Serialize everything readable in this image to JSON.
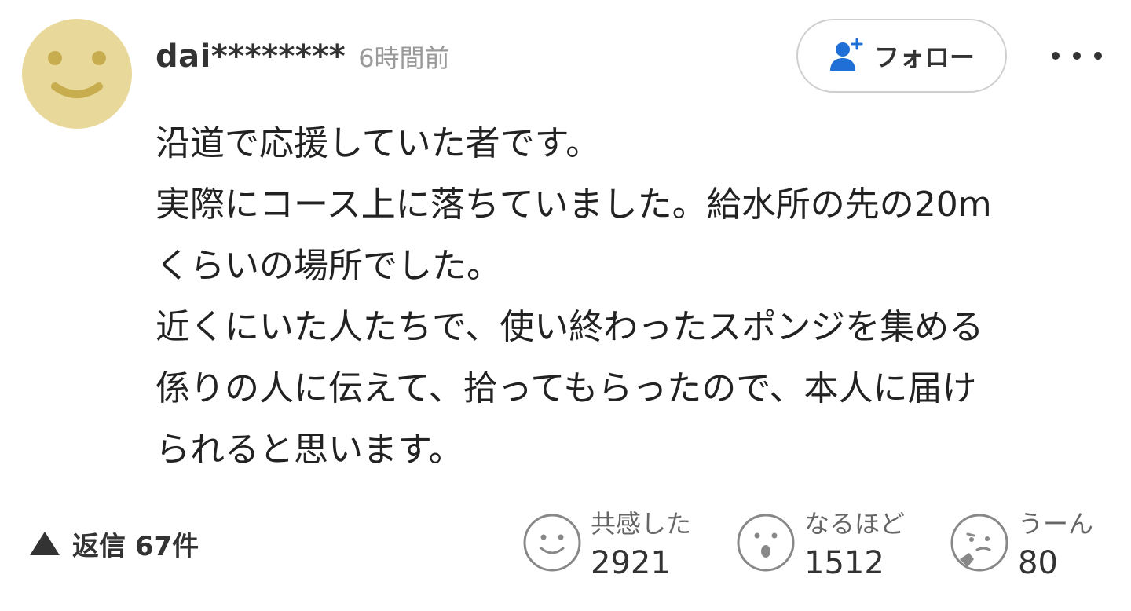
{
  "comment": {
    "username": "dai********",
    "time": "6時間前",
    "follow_label": "フォロー",
    "body_lines": [
      "沿道で応援していた者です。",
      "実際にコース上に落ちていました。給水所の先の20m",
      "くらいの場所でした。",
      "近くにいた人たちで、使い終わったスポンジを集める",
      "係りの人に伝えて、拾ってもらったので、本人に届け",
      "られると思います。"
    ]
  },
  "footer": {
    "replies_label": "返信 67件",
    "reactions": [
      {
        "icon": "smile-face-icon",
        "label": "共感した",
        "count": "2921"
      },
      {
        "icon": "surprised-face-icon",
        "label": "なるほど",
        "count": "1512"
      },
      {
        "icon": "thinking-face-icon",
        "label": "うーん",
        "count": "80"
      }
    ]
  },
  "colors": {
    "avatar_bg": "#e8d89a",
    "avatar_face": "#c8ad4e",
    "follow_icon": "#1f6fd6",
    "muted_text": "#9a9a9a",
    "icon_gray": "#888888"
  }
}
